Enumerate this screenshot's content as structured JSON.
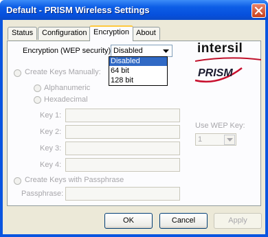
{
  "window": {
    "title": "Default - PRISM Wireless Settings"
  },
  "tabs": [
    {
      "label": "Status"
    },
    {
      "label": "Configuration"
    },
    {
      "label": "Encryption"
    },
    {
      "label": "About"
    }
  ],
  "encryption": {
    "label": "Encryption (WEP security):",
    "selected": "Disabled",
    "options": [
      "Disabled",
      "64 bit",
      "128 bit"
    ]
  },
  "manual": {
    "radio_label": "Create Keys Manually:",
    "alphanumeric": "Alphanumeric",
    "hexadecimal": "Hexadecimal",
    "keys": [
      {
        "label": "Key 1:",
        "value": ""
      },
      {
        "label": "Key 2:",
        "value": ""
      },
      {
        "label": "Key 3:",
        "value": ""
      },
      {
        "label": "Key 4:",
        "value": ""
      }
    ]
  },
  "use_wep_key": {
    "label": "Use WEP Key:",
    "value": "1"
  },
  "passphrase": {
    "radio_label": "Create Keys with Passphrase",
    "label": "Passphrase:",
    "value": ""
  },
  "logos": {
    "intersil": "intersil",
    "prism": "PRISM"
  },
  "buttons": {
    "ok": "OK",
    "cancel": "Cancel",
    "apply": "Apply"
  }
}
